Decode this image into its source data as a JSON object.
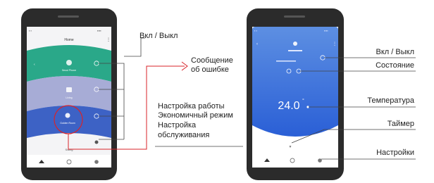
{
  "phone_left": {
    "title": "Home",
    "card_1": "Seoul Phone",
    "card_2": "Living",
    "card_3": "Golden Room",
    "bottom_text": "Swing"
  },
  "phone_right": {
    "temperature": "24.0",
    "unit": "°"
  },
  "callouts": {
    "on_off_left": "Вкл / Выкл",
    "error_msg_line1": "Сообщение",
    "error_msg_line2": "об ошибке",
    "settings_line1": "Настройка работы",
    "settings_line2": "Экономичный режим",
    "settings_line3": "Настройка",
    "settings_line4": "обслуживания",
    "on_off_right": "Вкл / Выкл",
    "state": "Состояние",
    "temperature": "Температура",
    "timer": "Таймер",
    "settings": "Настройки"
  },
  "colors": {
    "phone_body": "#2b2b2b",
    "teal": "#2aa889",
    "lavender": "#a7acd6",
    "blue": "#3d62c5",
    "right_grad_top": "#6ea0e6",
    "right_grad_bottom": "#1f54d0",
    "error_highlight": "#d8232a"
  }
}
